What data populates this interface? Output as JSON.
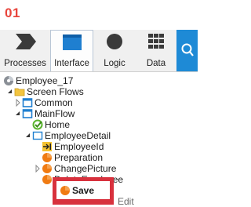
{
  "step": {
    "number": "01"
  },
  "toolbar": {
    "tabs": [
      {
        "label": "Processes",
        "icon": "processes-icon",
        "active": false
      },
      {
        "label": "Interface",
        "icon": "interface-icon",
        "active": true
      },
      {
        "label": "Logic",
        "icon": "logic-icon",
        "active": false
      },
      {
        "label": "Data",
        "icon": "data-icon",
        "active": false
      }
    ],
    "search_icon": "search-icon"
  },
  "tree": {
    "module": "Employee_17",
    "screen_flows": "Screen Flows",
    "common": "Common",
    "mainflow": "MainFlow",
    "home": "Home",
    "employee_detail": "EmployeeDetail",
    "employee_id": "EmployeeId",
    "preparation": "Preparation",
    "change_picture": "ChangePicture",
    "delete_employee": "DeleteEmployee",
    "save": "Save",
    "partial_next": "Edit"
  },
  "colors": {
    "accent_red": "#d8313d",
    "search_blue": "#1e8ad6",
    "action_orange": "#f07b12"
  }
}
